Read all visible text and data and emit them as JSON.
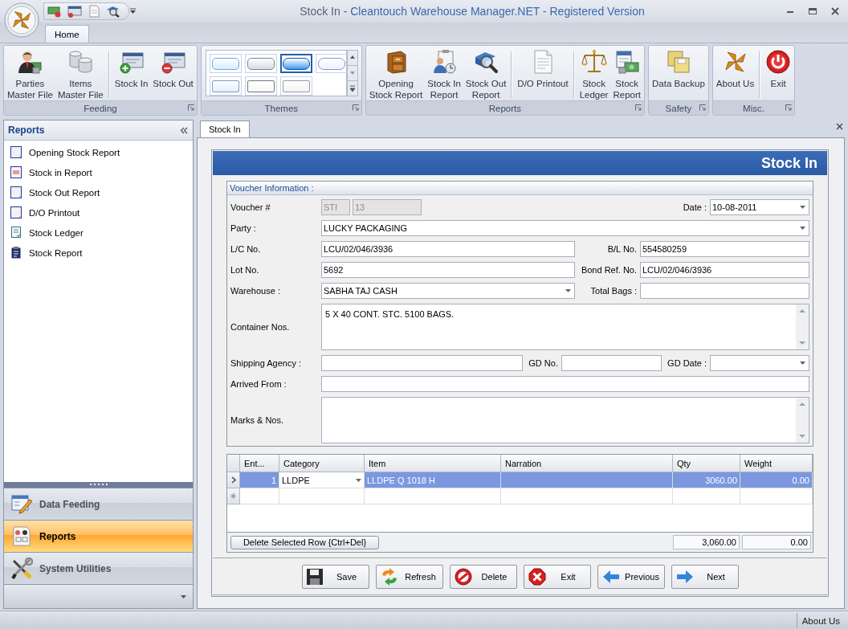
{
  "window": {
    "document": "Stock In -",
    "title": "Cleantouch Warehouse Manager.NET - Registered Version"
  },
  "ribbon": {
    "tabs": [
      {
        "label": "Home",
        "selected": true
      }
    ],
    "groups": [
      {
        "label": "Feeding",
        "kind": "buttons",
        "items": [
          {
            "kind": "button",
            "label": "Parties\nMaster File"
          },
          {
            "kind": "button",
            "label": "Items\nMaster File"
          },
          {
            "kind": "separator"
          },
          {
            "kind": "button",
            "label": "Stock In"
          },
          {
            "kind": "button",
            "label": "Stock Out"
          }
        ]
      },
      {
        "label": "Themes",
        "kind": "gallery",
        "swatches": [
          {
            "selected": false
          },
          {
            "selected": false
          },
          {
            "selected": true
          },
          {
            "selected": false
          },
          {
            "selected": false
          },
          {
            "selected": false
          },
          {
            "selected": false
          }
        ]
      },
      {
        "label": "Reports",
        "kind": "buttons",
        "items": [
          {
            "kind": "button",
            "label": "Opening\nStock Report"
          },
          {
            "kind": "button",
            "label": "Stock In\nReport"
          },
          {
            "kind": "button",
            "label": "Stock Out\nReport"
          },
          {
            "kind": "separator"
          },
          {
            "kind": "button",
            "label": "D/O Printout"
          },
          {
            "kind": "separator"
          },
          {
            "kind": "button",
            "label": "Stock\nLedger"
          },
          {
            "kind": "button",
            "label": "Stock\nReport"
          }
        ]
      },
      {
        "label": "Safety",
        "kind": "buttons",
        "items": [
          {
            "kind": "button",
            "label": "Data Backup"
          }
        ]
      },
      {
        "label": "Misc.",
        "kind": "buttons",
        "items": [
          {
            "kind": "button",
            "label": "About Us"
          },
          {
            "kind": "separator"
          },
          {
            "kind": "button",
            "label": "Exit"
          }
        ]
      }
    ]
  },
  "sidebar": {
    "title": "Reports",
    "items": [
      {
        "label": "Opening Stock Report"
      },
      {
        "label": "Stock in Report"
      },
      {
        "label": "Stock Out Report"
      },
      {
        "label": "D/O Printout"
      },
      {
        "label": "Stock Ledger"
      },
      {
        "label": "Stock Report"
      }
    ],
    "nav": [
      {
        "label": "Data Feeding",
        "selected": false
      },
      {
        "label": "Reports",
        "selected": true
      },
      {
        "label": "System Utilities",
        "selected": false
      }
    ]
  },
  "doc_tabs": [
    {
      "label": "Stock In",
      "selected": true
    }
  ],
  "form": {
    "title": "Stock In",
    "voucher": {
      "title": "Voucher Information :",
      "rows": [
        [
          {
            "label": "Voucher #",
            "kind": "code",
            "disabled": true,
            "values": [
              "STI",
              "13"
            ]
          },
          {
            "label": "Date :",
            "kind": "combo",
            "value": "10-08-2011"
          }
        ],
        [
          {
            "label": "Party :",
            "kind": "combo",
            "value": "LUCKY PACKAGING"
          }
        ],
        [
          {
            "label": "L/C No.",
            "kind": "text",
            "value": "LCU/02/046/3936"
          },
          {
            "label": "B/L No.",
            "kind": "text",
            "value": "554580259"
          }
        ],
        [
          {
            "label": "Lot No.",
            "kind": "text",
            "value": "5692"
          },
          {
            "label": "Bond Ref. No.",
            "kind": "text",
            "value": "LCU/02/046/3936"
          }
        ],
        [
          {
            "label": "Warehouse :",
            "kind": "combo",
            "value": "SABHA TAJ CASH"
          },
          {
            "label": "Total Bags :",
            "kind": "text"
          }
        ],
        [
          {
            "label": "Container Nos.",
            "kind": "memo",
            "value": "5 X 40 CONT. STC. 5100 BAGS."
          }
        ],
        [
          {
            "label": "Shipping Agency :",
            "kind": "text"
          },
          {
            "label": "GD No.",
            "kind": "text"
          },
          {
            "label": "GD Date :",
            "kind": "combo"
          }
        ],
        [
          {
            "label": "Arrived From :",
            "kind": "text"
          }
        ],
        [
          {
            "label": "Marks & Nos.",
            "kind": "memo"
          }
        ]
      ]
    },
    "grid": {
      "columns": [
        "Ent...",
        "Category",
        "Item",
        "Narration",
        "Qty",
        "Weight"
      ],
      "rows": [
        {
          "selected": true,
          "entry": "1",
          "category": "LLDPE",
          "item": "LLDPE Q 1018 H",
          "qty": "3060.00",
          "weight": "0.00"
        }
      ],
      "delete_button": "Delete Selected Row {Ctrl+Del}",
      "totals": {
        "qty": "3,060.00",
        "weight": "0.00"
      }
    },
    "buttons": [
      "Save",
      "Refresh",
      "Delete",
      "Exit",
      "Previous",
      "Next"
    ]
  },
  "status_bar": {
    "text": "About Us"
  }
}
